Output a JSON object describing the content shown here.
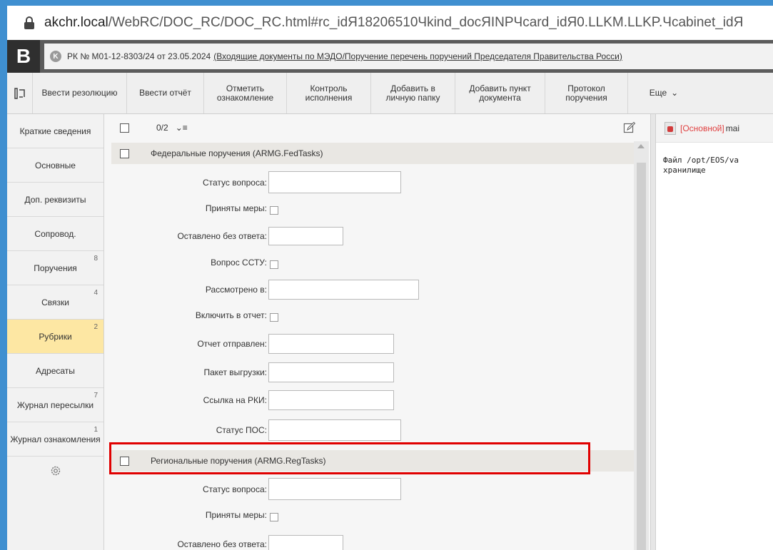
{
  "browser": {
    "url_host": "akchr.local",
    "url_path": "/WebRC/DOC_RC/DOC_RC.html#rc_idЯ18206510Чkind_docЯINPЧcard_idЯ0.LLKM.LLKP.Чcabinet_idЯ"
  },
  "header": {
    "logo": "B",
    "k_badge": "K",
    "doc_prefix": "РК № М01-12-8303/24 от 23.05.2024",
    "doc_link": "(Входящие документы по МЭДО/Поручение перечень поручений Председателя Правительства Росси)"
  },
  "toolbar": {
    "items": [
      "Ввести резолюцию",
      "Ввести отчёт",
      "Отметить ознакомление",
      "Контроль исполнения",
      "Добавить в личную папку",
      "Добавить пункт документа",
      "Протокол поручения",
      "Еще"
    ]
  },
  "sidebar": {
    "items": [
      {
        "label": "Краткие сведения",
        "count": ""
      },
      {
        "label": "Основные",
        "count": ""
      },
      {
        "label": "Доп. реквизиты",
        "count": ""
      },
      {
        "label": "Сопровод.",
        "count": ""
      },
      {
        "label": "Поручения",
        "count": "8"
      },
      {
        "label": "Связки",
        "count": "4"
      },
      {
        "label": "Рубрики",
        "count": "2"
      },
      {
        "label": "Адресаты",
        "count": ""
      },
      {
        "label": "Журнал пересылки",
        "count": "7"
      },
      {
        "label": "Журнал ознакомления",
        "count": "1"
      }
    ],
    "active_index": 6
  },
  "main": {
    "counter": "0/2",
    "sort_glyph": "⌄≡",
    "sections": [
      {
        "title": "Федеральные поручения (ARMG.FedTasks)",
        "fields": {
          "status": "Статус вопроса:",
          "measures": "Приняты меры:",
          "no_answer": "Оставлено без ответа:",
          "sstu": "Вопрос ССТУ:",
          "reviewed": "Рассмотрено в:",
          "include": "Включить в отчет:",
          "report_sent": "Отчет отправлен:",
          "package": "Пакет выгрузки:",
          "rki_link": "Ссылка на РКИ:",
          "pos_status": "Статус ПОС:"
        }
      },
      {
        "title": "Региональные поручения (ARMG.RegTasks)",
        "fields": {
          "status": "Статус вопроса:",
          "measures": "Приняты меры:",
          "no_answer": "Оставлено без ответа:"
        }
      }
    ]
  },
  "files": {
    "tag": "[Основной]",
    "name": "mai",
    "message_line1": "Файл /opt/EOS/va",
    "message_line2": "хранилище"
  },
  "colors": {
    "frame": "#3f8fd0",
    "active_tab": "#fde7a3",
    "highlight": "#e00000"
  }
}
